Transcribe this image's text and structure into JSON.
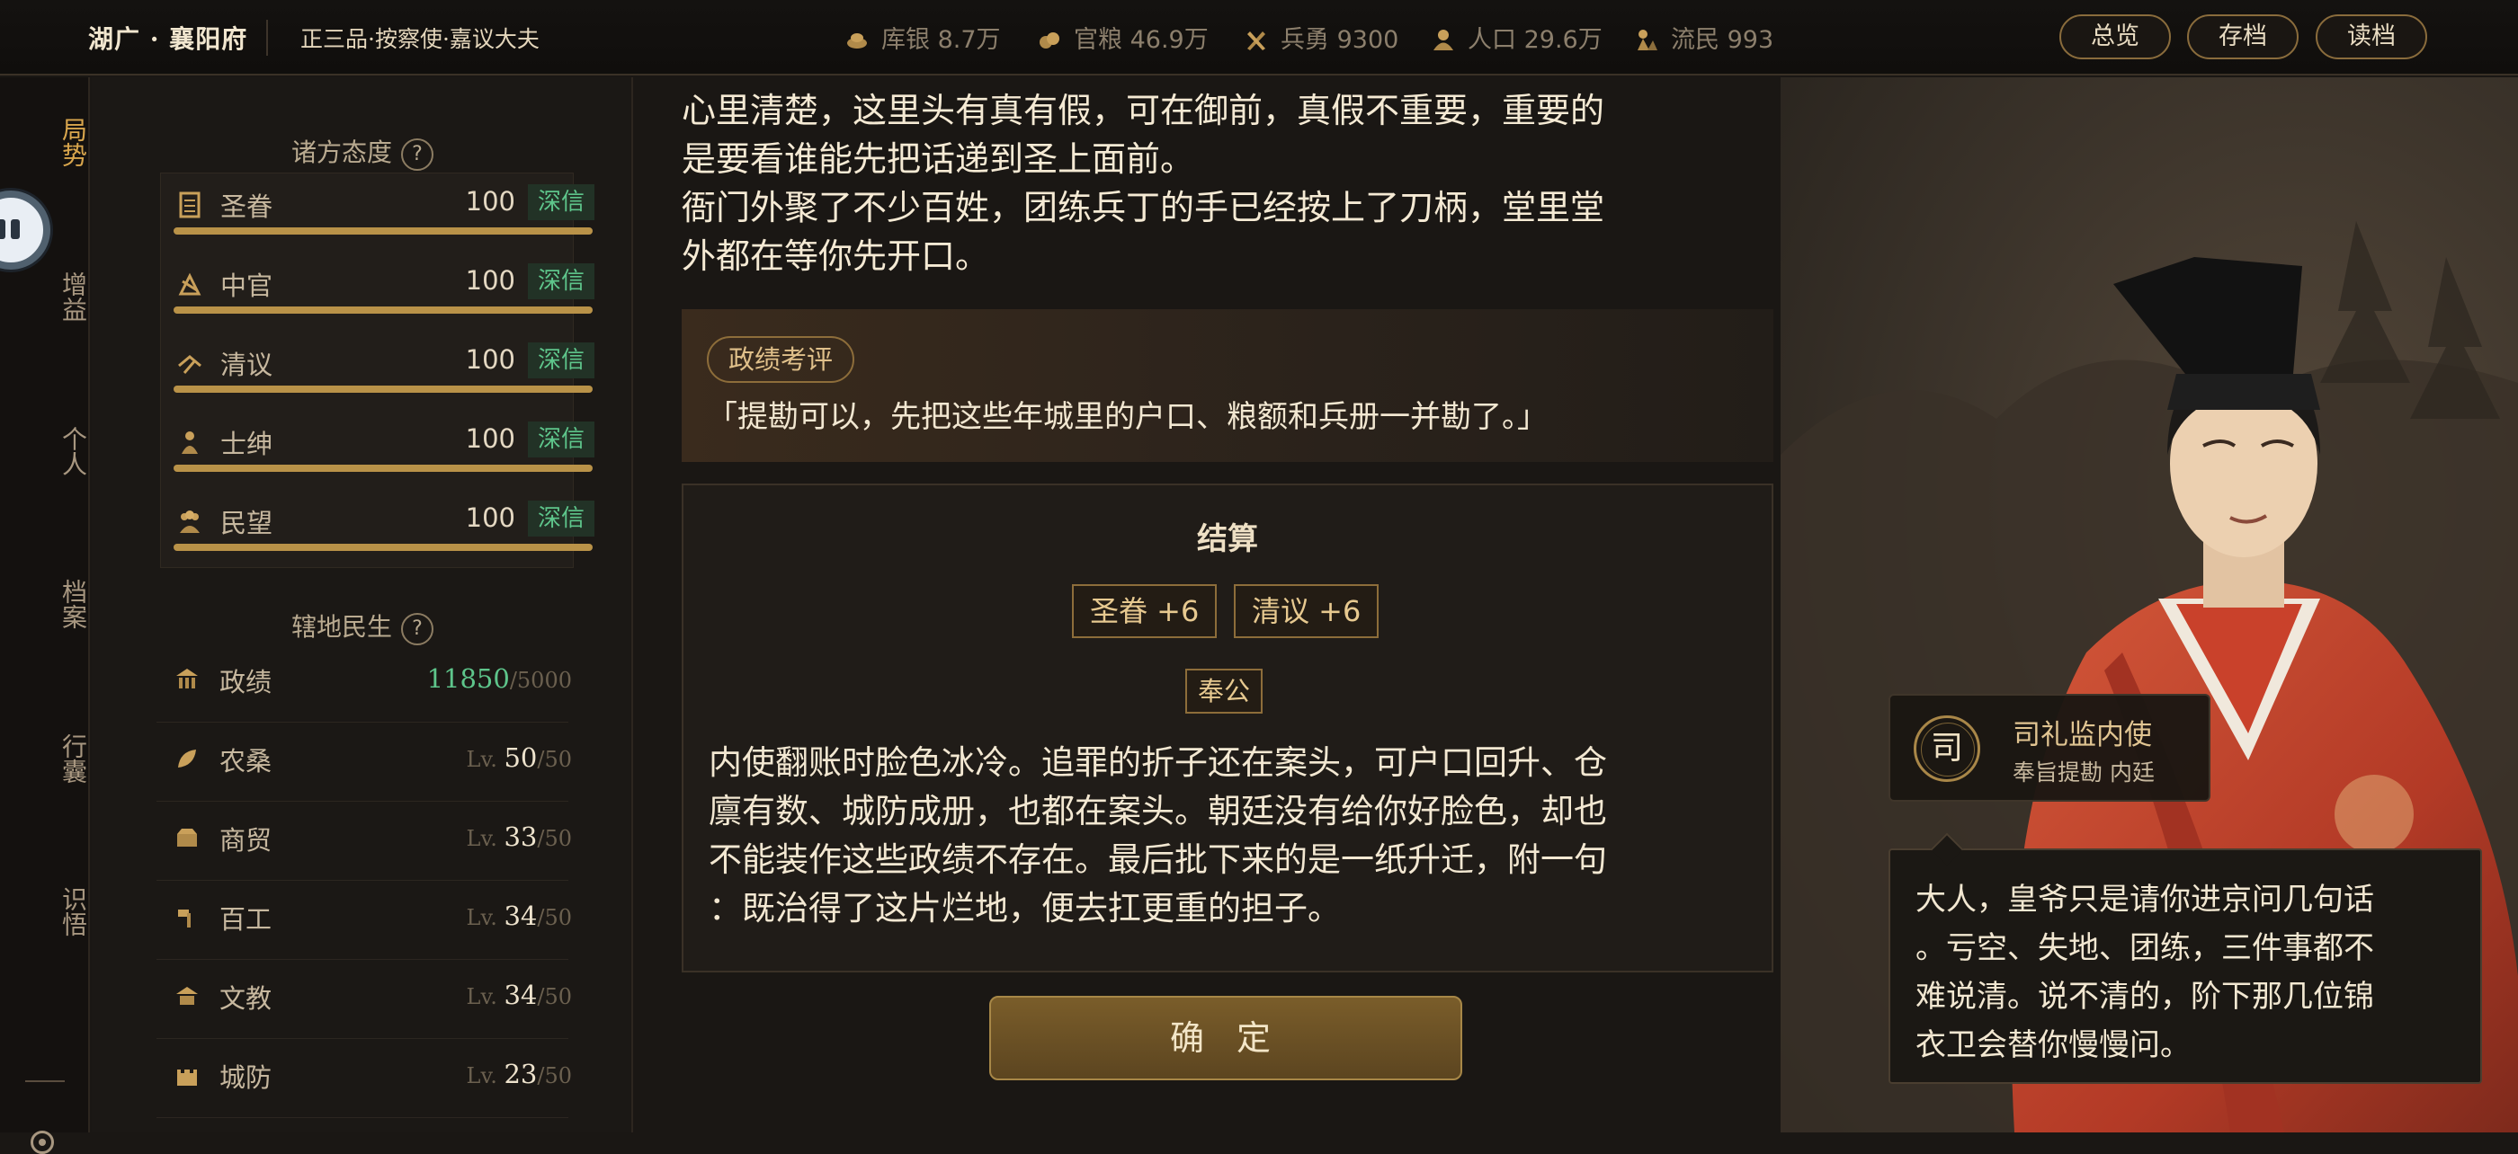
{
  "header": {
    "region": "湖广 · 襄阳府",
    "rank": "正三品·按察使·嘉议大夫",
    "resources": [
      {
        "icon": "silver-icon",
        "label": "库银 8.7万"
      },
      {
        "icon": "grain-icon",
        "label": "官粮 46.9万"
      },
      {
        "icon": "soldier-icon",
        "label": "兵勇 9300"
      },
      {
        "icon": "population-icon",
        "label": "人口 29.6万"
      },
      {
        "icon": "refugee-icon",
        "label": "流民 993"
      }
    ],
    "buttons": {
      "overview": "总览",
      "save": "存档",
      "load": "读档"
    }
  },
  "rail": {
    "items": [
      "局势",
      "增益",
      "个人",
      "档案",
      "行囊",
      "识悟"
    ]
  },
  "attitudes": {
    "title": "诸方态度",
    "help": "?",
    "rows": [
      {
        "name": "圣眷",
        "value": "100",
        "tag": "深信",
        "level": 1.0
      },
      {
        "name": "中官",
        "value": "100",
        "tag": "深信",
        "level": 1.0
      },
      {
        "name": "清议",
        "value": "100",
        "tag": "深信",
        "level": 1.0
      },
      {
        "name": "士绅",
        "value": "100",
        "tag": "深信",
        "level": 1.0
      },
      {
        "name": "民望",
        "value": "100",
        "tag": "深信",
        "level": 1.0
      }
    ]
  },
  "territory": {
    "title": "辖地民生",
    "help": "?",
    "merit": {
      "name": "政绩",
      "value": "11850",
      "max": "/5000"
    },
    "rows": [
      {
        "name": "农桑",
        "lv": "Lv.",
        "value": "50",
        "max": "/50"
      },
      {
        "name": "商贸",
        "lv": "Lv.",
        "value": "33",
        "max": "/50"
      },
      {
        "name": "百工",
        "lv": "Lv.",
        "value": "34",
        "max": "/50"
      },
      {
        "name": "文教",
        "lv": "Lv.",
        "value": "34",
        "max": "/50"
      },
      {
        "name": "城防",
        "lv": "Lv.",
        "value": "23",
        "max": "/50"
      }
    ]
  },
  "story": {
    "lines": [
      "心里清楚，这里头有真有假，可在御前，真假不重要，重要的",
      "是要看谁能先把话递到圣上面前。",
      "衙门外聚了不少百姓，团练兵丁的手已经按上了刀柄，堂里堂",
      "外都在等你先开口。"
    ]
  },
  "comment": {
    "chip": "政绩考评",
    "quote": "「提勘可以，先把这些年城里的户口、粮额和兵册一并勘了。」"
  },
  "settlement": {
    "title": "结算",
    "rewards": [
      "圣眷 +6",
      "清议 +6"
    ],
    "choice": "奉公",
    "lines": [
      "内使翻账时脸色冰冷。追罪的折子还在案头，可户口回升、仓",
      "廪有数、城防成册，也都在案头。朝廷没有给你好脸色，却也",
      "不能装作这些政绩不存在。最后批下来的是一纸升迁，附一句",
      "：既治得了这片烂地，便去扛更重的担子。"
    ]
  },
  "confirm_label": "确 定",
  "npc": {
    "seal": "司",
    "name": "司礼监内使",
    "subtitle": "奉旨提勘 内廷",
    "dialogue": [
      "大人，皇爷只是请你进京问几句话",
      "。亏空、失地、团练，三件事都不",
      "难说清。说不清的，阶下那几位锦",
      "衣卫会替你慢慢问。"
    ]
  },
  "colors": {
    "accent_gold": "#b99248",
    "trust_green": "#5ec58b",
    "robe_red": "#c2442c"
  }
}
